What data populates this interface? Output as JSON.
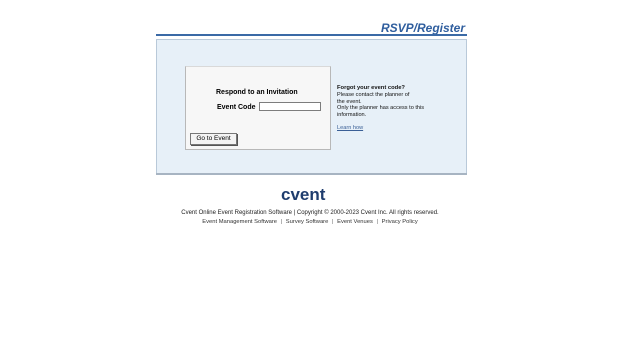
{
  "header": {
    "title": "RSVP/Register"
  },
  "panel": {
    "title": "Respond to an Invitation",
    "code_label": "Event Code",
    "code_value": "",
    "button_label": "Go to Event",
    "help_title": "Forgot your event code?",
    "help_line1": "Please contact the planner of",
    "help_line2": "the event.",
    "help_line3": "Only the planner has access to this",
    "help_line4": "information.",
    "learn_link": "Learn how"
  },
  "logo": {
    "text": "cvent",
    "icon": "cvent-logo",
    "color": "#1f3d6e"
  },
  "footer": {
    "copyright": "Cvent Online Event Registration Software | Copyright © 2000-2023 Cvent Inc. All rights reserved.",
    "links": [
      "Event Management Software",
      "Survey Software",
      "Event Venues",
      "Privacy Policy"
    ],
    "separator": "|"
  }
}
